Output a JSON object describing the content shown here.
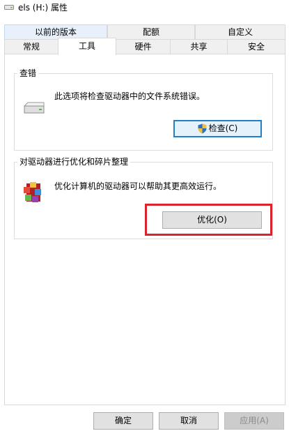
{
  "window": {
    "title": "els (H:) 属性",
    "icon": "drive-icon"
  },
  "tabs": {
    "row1": [
      "以前的版本",
      "配额",
      "自定义"
    ],
    "row2": [
      "常规",
      "工具",
      "硬件",
      "共享",
      "安全"
    ],
    "active": "工具"
  },
  "error_check": {
    "title": "查错",
    "description": "此选项将检查驱动器中的文件系统错误。",
    "button_label": "检查(C)",
    "icon": "hard-drive-icon"
  },
  "optimize": {
    "title": "对驱动器进行优化和碎片整理",
    "description": "优化计算机的驱动器可以帮助其更高效运行。",
    "button_label": "优化(O)",
    "icon": "defrag-icon"
  },
  "footer": {
    "ok_label": "确定",
    "cancel_label": "取消",
    "apply_label": "应用(A)"
  },
  "colors": {
    "highlight": "#d9232d",
    "focus_border": "#1f7fc8"
  }
}
